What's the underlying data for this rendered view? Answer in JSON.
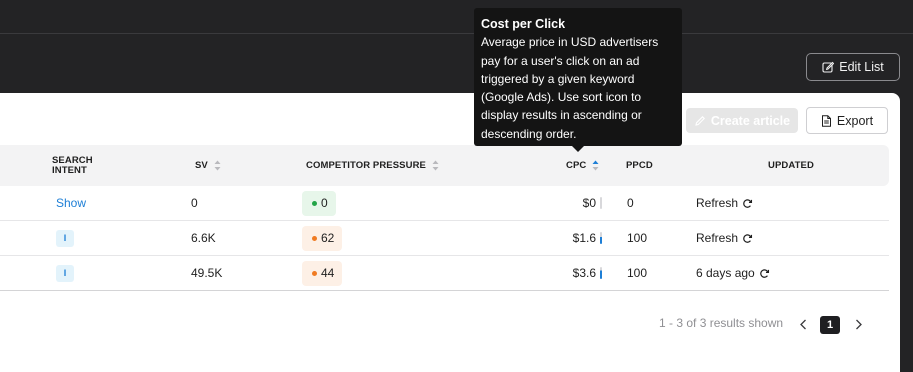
{
  "header": {
    "edit_list_label": "Edit List"
  },
  "toolbar": {
    "create_article_label": "Create article",
    "export_label": "Export"
  },
  "table": {
    "columns": {
      "search_intent_line1": "SEARCH",
      "search_intent_line2": "INTENT",
      "sv": "SV",
      "competitor_pressure": "COMPETITOR PRESSURE",
      "cpc": "CPC",
      "ppcd": "PPCD",
      "updated": "UPDATED"
    },
    "rows": [
      {
        "intent": "Show",
        "sv": "0",
        "pressure": "0",
        "cpc": "$0",
        "ppcd": "0",
        "updated": "Refresh"
      },
      {
        "intent": "I",
        "sv": "6.6K",
        "pressure": "62",
        "cpc": "$1.6",
        "ppcd": "100",
        "updated": "Refresh"
      },
      {
        "intent": "I",
        "sv": "49.5K",
        "pressure": "44",
        "cpc": "$3.6",
        "ppcd": "100",
        "updated": "6 days ago"
      }
    ]
  },
  "pagination": {
    "summary": "1 - 3 of 3 results shown",
    "current_page": "1"
  },
  "tooltip": {
    "title": "Cost per Click",
    "body": "Average price in USD advertisers pay for a user's click on an ad triggered by a given keyword (Google Ads). Use sort icon to display results in ascending or descending order."
  },
  "colors": {
    "background": "#232325",
    "accent": "#1e7fd6",
    "pressure_low": "#22a447",
    "pressure_low_bg": "#e7f6ea",
    "pressure_mid": "#f07b22",
    "pressure_mid_bg": "#fdf0e6",
    "tooltip_bg": "#141414"
  },
  "icons": {
    "edit": "edit-icon",
    "create": "pencil-icon",
    "export": "document-icon",
    "sort": "sort-icon",
    "refresh": "refresh-icon",
    "prev": "chevron-left-icon",
    "next": "chevron-right-icon"
  }
}
